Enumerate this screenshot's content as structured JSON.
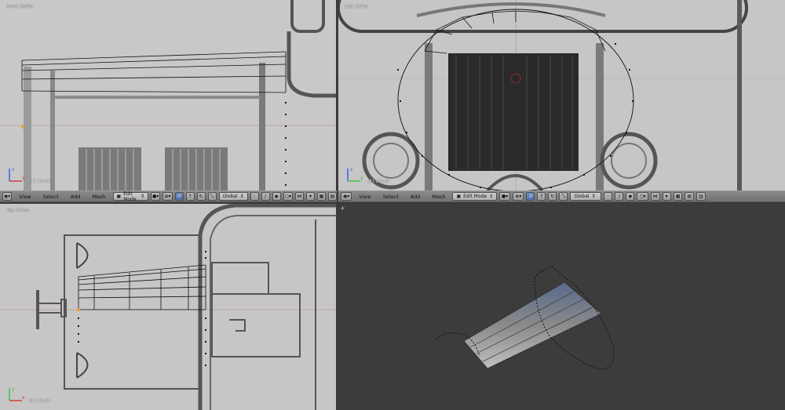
{
  "viewports": {
    "front": {
      "label": "Front Ortho",
      "object": "(1) Circle"
    },
    "left": {
      "label": "Left Ortho",
      "object": "(1) Circle"
    },
    "top": {
      "label": "Top Ortho",
      "object": "(1) Circle"
    }
  },
  "header": {
    "view": "View",
    "select": "Select",
    "add": "Add",
    "mesh": "Mesh",
    "mode": "Edit Mode",
    "orientation": "Global"
  },
  "colors": {
    "header_bg": "#7c7c7c",
    "viewport_3d_bg": "#3c3c3c",
    "reference_bg": "#c4c4c4",
    "selected_vertex": "#e8a030",
    "axis_x": "#d04040",
    "axis_y": "#40c040",
    "axis_z": "#4060e0"
  }
}
